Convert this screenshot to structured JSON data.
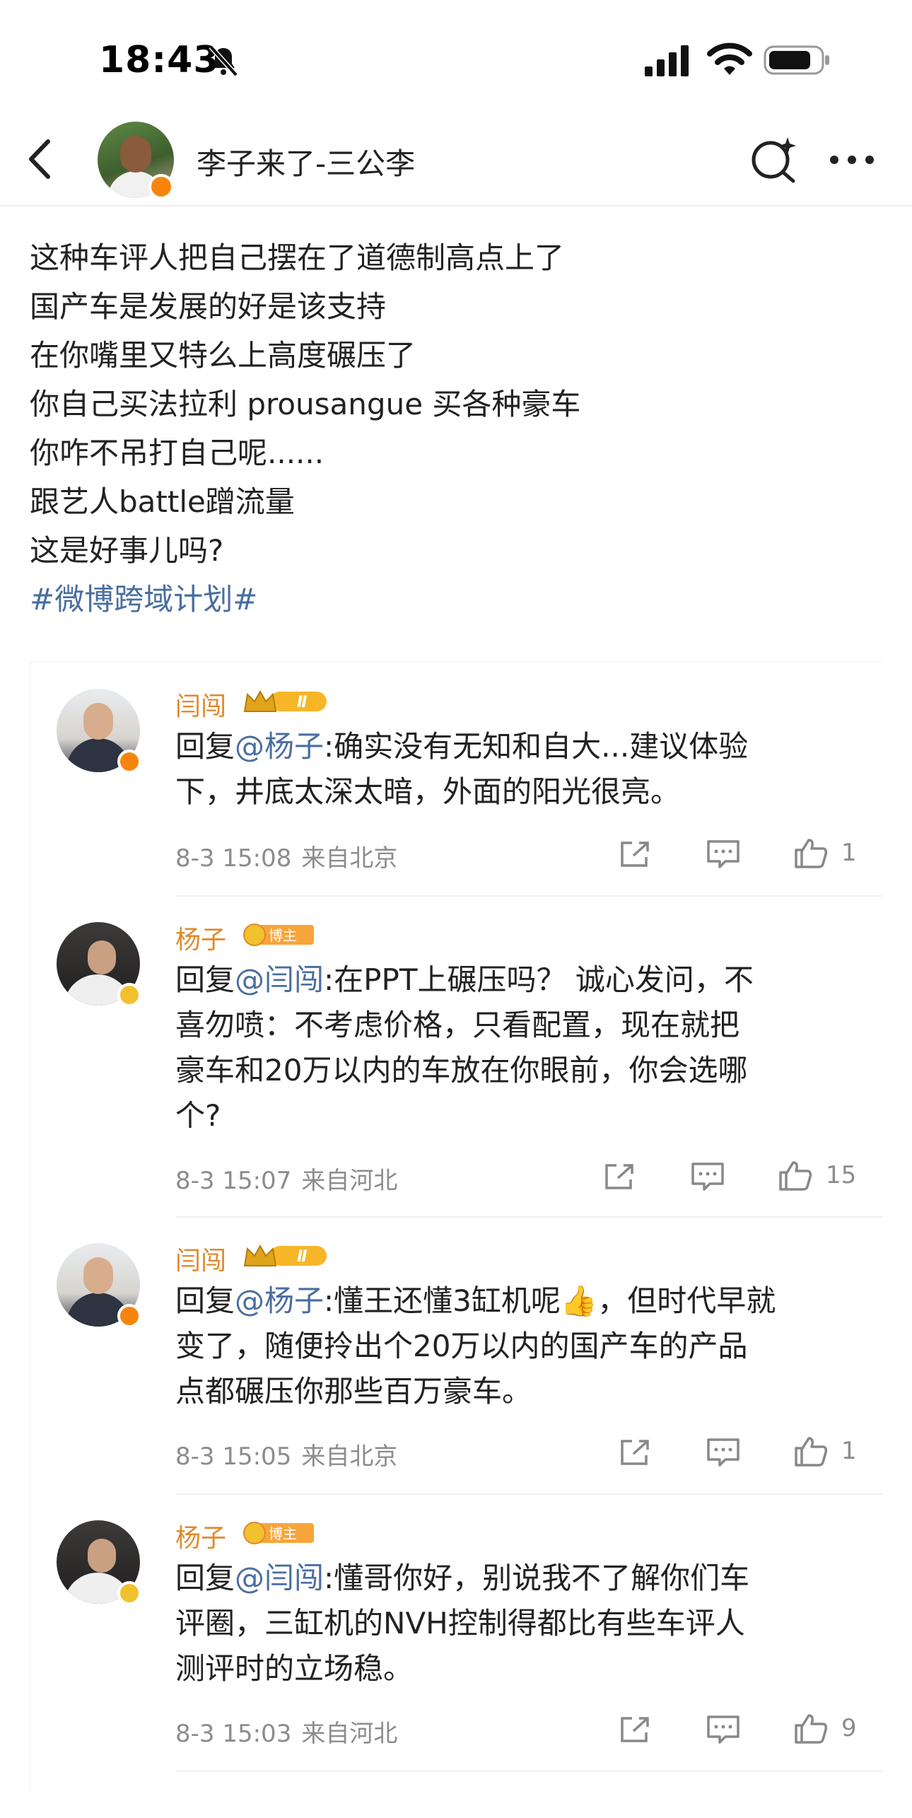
{
  "status_bar": {
    "time": "18:43",
    "icons": [
      "bell-slash-icon",
      "signal-icon",
      "wifi-icon",
      "battery-icon"
    ]
  },
  "nav": {
    "title": "李子来了-三公李",
    "icons": [
      "back-chevron-icon",
      "search-sparkle-icon",
      "more-dots-icon"
    ]
  },
  "post": {
    "lines": [
      "这种车评人把自己摆在了道德制高点上了",
      "国产车是发展的好是该支持",
      "在你嘴里又特么上高度碾压了",
      "你自己买法拉利 prousangue 买各种豪车",
      "你咋不吊打自己呢......",
      "跟艺人battle蹭流量",
      "这是好事儿吗?"
    ],
    "topic": "#微博跨域计划#"
  },
  "comments": [
    {
      "user": "闫闯",
      "badge": "Ⅱ",
      "reply_prefix": "回复",
      "mention": "@杨子",
      "lines": [
        ":确实没有无知和自大...建议体验",
        "下，井底太深太暗，外面的阳光很亮。"
      ],
      "date": "8-3 15:08",
      "source": "来自北京",
      "likes": "1"
    },
    {
      "user": "杨子",
      "badge": "博主",
      "reply_prefix": "回复",
      "mention": "@闫闯",
      "lines": [
        ":在PPT上碾压吗？ 诚心发问，不",
        "喜勿喷：不考虑价格，只看配置，现在就把",
        "豪车和20万以内的车放在你眼前，你会选哪",
        "个?"
      ],
      "date": "8-3 15:07",
      "source": "来自河北",
      "likes": "15"
    },
    {
      "user": "闫闯",
      "badge": "Ⅱ",
      "reply_prefix": "回复",
      "mention": "@杨子",
      "lines": [
        ":懂王还懂3缸机呢👍，但时代早就",
        "变了，随便拎出个20万以内的国产车的产品",
        "点都碾压你那些百万豪车。"
      ],
      "date": "8-3 15:05",
      "source": "来自北京",
      "likes": "1"
    },
    {
      "user": "杨子",
      "badge": "博主",
      "reply_prefix": "回复",
      "mention": "@闫闯",
      "lines": [
        ":懂哥你好，别说我不了解你们车",
        "评圈，三缸机的NVH控制得都比有些车评人",
        "测评时的立场稳。"
      ],
      "date": "8-3 15:03",
      "source": "来自河北",
      "likes": "9"
    }
  ],
  "colors": {
    "link": "#4a6ea0",
    "username": "#e0892b",
    "meta": "#8c8c8c",
    "vip_orange": "#f7850d",
    "vip_gold": "#f2c12e"
  }
}
